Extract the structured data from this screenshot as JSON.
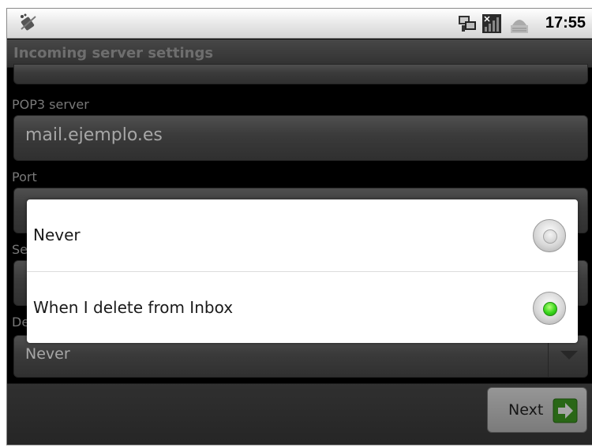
{
  "status_bar": {
    "time": "17:55",
    "icons": [
      "phone-signal-off-icon",
      "network-icon",
      "signal-bars-no-sim-icon",
      "usb-debug-icon"
    ]
  },
  "header": {
    "title": "Incoming server settings"
  },
  "form": {
    "pop3_label": "POP3 server",
    "pop3_value": "mail.ejemplo.es",
    "port_label": "Port",
    "security_label_partial": "Se",
    "delete_label_partial": "De",
    "delete_value": "Never"
  },
  "dialog": {
    "options": [
      {
        "label": "Never",
        "selected": false
      },
      {
        "label": "When I delete from Inbox",
        "selected": true
      }
    ]
  },
  "footer": {
    "next_label": "Next"
  },
  "colors": {
    "radio_selected": "#37d61b",
    "next_icon": "#4caf2a"
  }
}
